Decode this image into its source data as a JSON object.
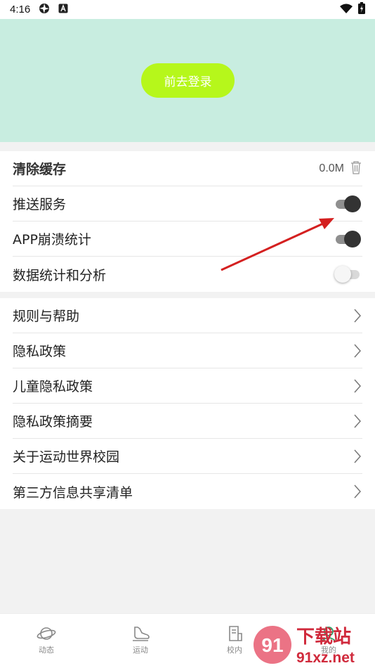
{
  "status_bar": {
    "time": "4:16",
    "icons": [
      "camera-aperture-icon",
      "a-badge-icon",
      "wifi-icon",
      "battery-charging-icon"
    ]
  },
  "header": {
    "login_button": "前去登录",
    "accent": "#b6f71b",
    "background": "#c8ede0"
  },
  "settings": [
    {
      "label": "清除缓存",
      "value": "0.0M",
      "icon": "trash-icon"
    },
    {
      "label": "推送服务",
      "toggle": true
    },
    {
      "label": "APP崩溃统计",
      "toggle": true
    },
    {
      "label": "数据统计和分析",
      "toggle": false
    }
  ],
  "links": [
    {
      "label": "规则与帮助"
    },
    {
      "label": "隐私政策"
    },
    {
      "label": "儿童隐私政策"
    },
    {
      "label": "隐私政策摘要"
    },
    {
      "label": "关于运动世界校园"
    },
    {
      "label": "第三方信息共享清单"
    }
  ],
  "tabbar": [
    {
      "label": "动态",
      "icon": "planet-icon"
    },
    {
      "label": "运动",
      "icon": "shoe-icon"
    },
    {
      "label": "校内",
      "icon": "document-icon"
    },
    {
      "label": "我的",
      "icon": "profile-icon"
    }
  ],
  "watermark": {
    "brand": "下载站",
    "url": "91xz.net",
    "logo": "91"
  }
}
